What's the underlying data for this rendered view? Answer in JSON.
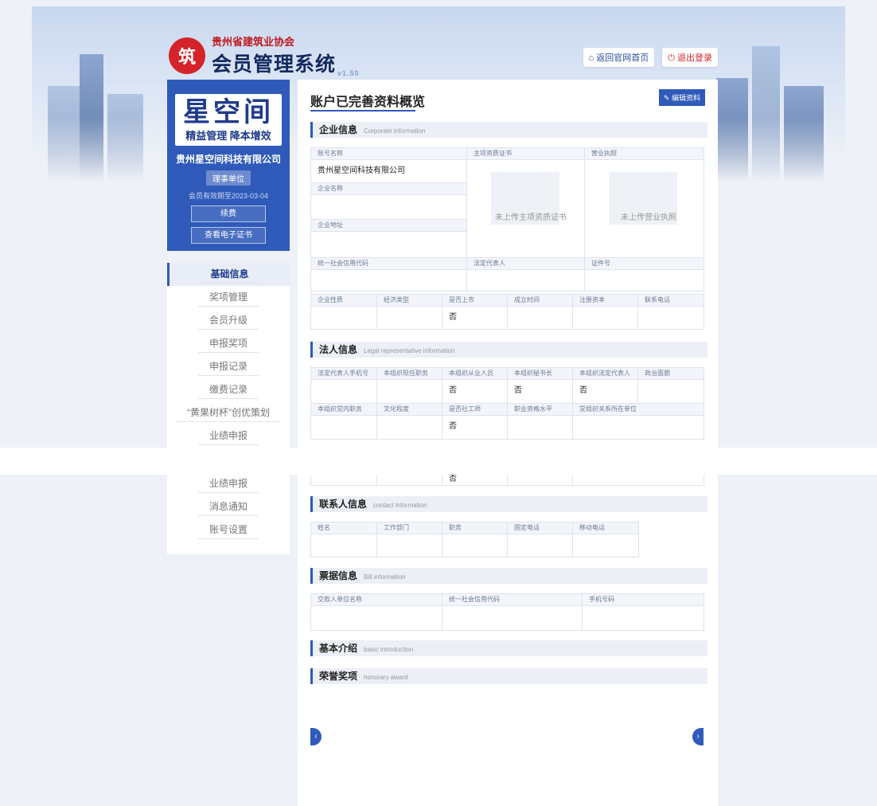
{
  "header": {
    "org": "贵州省建筑业协会",
    "system": "会员管理系统",
    "version": "v1.50",
    "home_link": "返回官网首页",
    "logout": "退出登录",
    "home_icon": "home-icon",
    "logout_icon": "power-icon"
  },
  "profile": {
    "brand_big": "星空间",
    "brand_small": "精益管理 降本增效",
    "company": "贵州星空间科技有限公司",
    "badge": "理事单位",
    "validity": "会员有效期至2023-03-04",
    "renew": "续费",
    "cert": "查看电子证书"
  },
  "nav": {
    "items": [
      {
        "label": "基础信息",
        "active": true
      },
      {
        "label": "奖项管理"
      },
      {
        "label": "会员升级"
      },
      {
        "label": "申报奖项"
      },
      {
        "label": "申报记录"
      },
      {
        "label": "缴费记录"
      },
      {
        "label": "“黄果树杯”创优策划"
      },
      {
        "label": "业绩申报"
      }
    ],
    "items2": [
      {
        "label": "业绩申报"
      },
      {
        "label": "消息通知"
      },
      {
        "label": "账号设置"
      }
    ]
  },
  "main": {
    "title": "账户已完善资料概览",
    "edit": "编辑资料",
    "corp": {
      "title": "企业信息",
      "en": "Corporate information",
      "account_label": "账号名称",
      "account_value": "贵州星空间科技有限公司",
      "name_label": "企业名称",
      "addr_label": "企业地址",
      "cert_label": "主项资质证书",
      "cert_empty": "未上传主项资质证书",
      "license_label": "营业执照",
      "license_empty": "未上传营业执照",
      "credit_label": "统一社会信用代码",
      "rep_label": "法定代表人",
      "id_label": "证件号",
      "row": [
        "企业性质",
        "经济类型",
        "是否上市",
        "成立时间",
        "注册资本",
        "联系电话"
      ],
      "row_values": [
        "",
        "",
        "否",
        "",
        "",
        ""
      ]
    },
    "legal": {
      "title": "法人信息",
      "en": "Legal representative information",
      "row1": [
        "法定代表人手机号",
        "本组织现任职务",
        "本组织从业人员",
        "本组织秘书长",
        "本组织法定代表人",
        "政治面貌"
      ],
      "row1_values": [
        "",
        "",
        "否",
        "否",
        "否",
        ""
      ],
      "row2": [
        "本组织党内职务",
        "文化程度",
        "是否社工师",
        "职业资格水平",
        "党组织关系所在单位"
      ],
      "row2_values": [
        "",
        "",
        "否",
        "",
        ""
      ],
      "repeat_value": "否"
    },
    "contact": {
      "title": "联系人信息",
      "en": "contact information",
      "cols": [
        "姓名",
        "工作部门",
        "职务",
        "固定电话",
        "移动电话"
      ]
    },
    "bill": {
      "title": "票据信息",
      "en": "Bill information",
      "cols": [
        "交款人单位名称",
        "统一社会信用代码",
        "手机号码"
      ]
    },
    "intro": {
      "title": "基本介绍",
      "en": "basic introduction"
    },
    "honor": {
      "title": "荣誉奖项",
      "en": "honorary award"
    },
    "prev_icon": "chevron-left-icon",
    "next_icon": "chevron-right-icon"
  }
}
